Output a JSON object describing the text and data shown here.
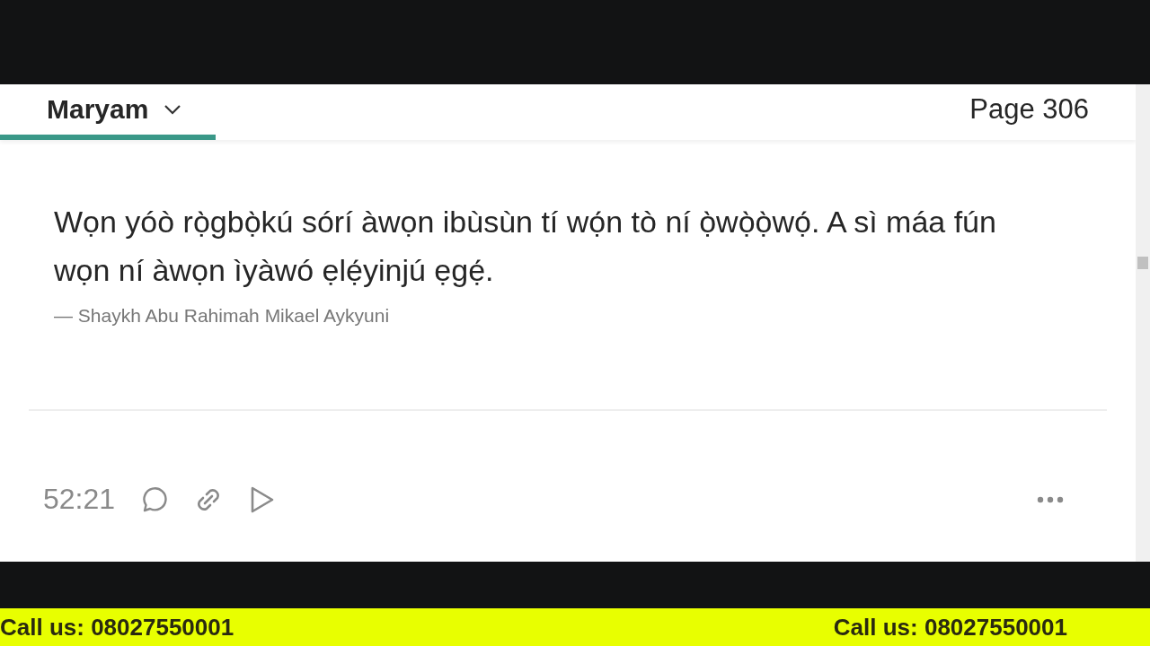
{
  "header": {
    "chapter": "Maryam",
    "page": "Page 306"
  },
  "progress": {
    "level": 0.19
  },
  "quote": {
    "text": "Wọn yóò rọ̀gbọ̀kú sórí àwọn ibùsùn tí wọ́n tò ní ọ̀wọ̀ọ̀wọ́. A sì máa fún wọn ní àwọn ìyàwó ẹlẹ́yinjú ẹgẹ́.",
    "attribution": "— Shaykh Abu Rahimah Mikael Aykyuni"
  },
  "footer": {
    "time": "52:21"
  },
  "banner": [
    "Call us: 08027550001",
    "Call us: 08027550001"
  ]
}
